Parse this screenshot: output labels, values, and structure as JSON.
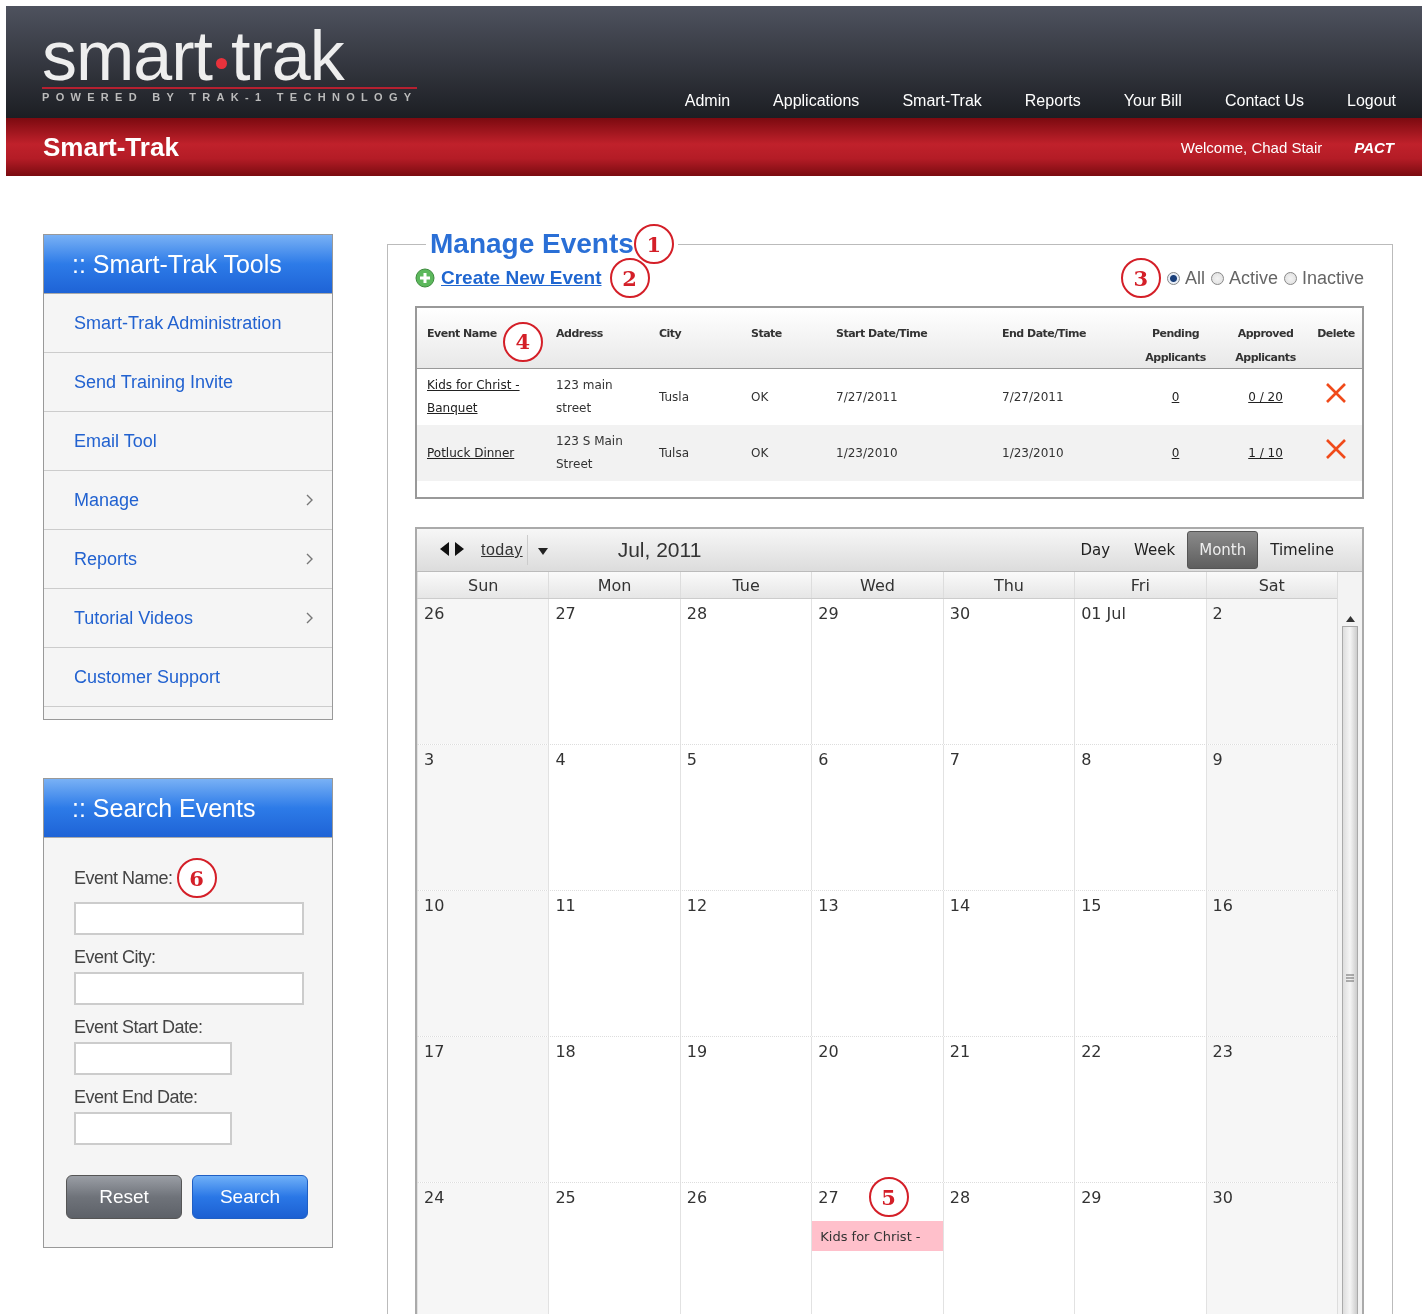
{
  "logo": {
    "left": "smart",
    "right": "trak",
    "tagline": "POWERED BY TRAK-1 TECHNOLOGY"
  },
  "nav": [
    "Admin",
    "Applications",
    "Smart-Trak",
    "Reports",
    "Your Bill",
    "Contact Us",
    "Logout"
  ],
  "banner": {
    "title": "Smart-Trak",
    "welcome": "Welcome, Chad Stair",
    "org": "PACT"
  },
  "tools": {
    "title": ":: Smart-Trak Tools",
    "items": [
      {
        "label": "Smart-Trak Administration",
        "submenu": false
      },
      {
        "label": "Send Training Invite",
        "submenu": false
      },
      {
        "label": "Email Tool",
        "submenu": false
      },
      {
        "label": "Manage",
        "submenu": true
      },
      {
        "label": "Reports",
        "submenu": true
      },
      {
        "label": "Tutorial Videos",
        "submenu": true
      },
      {
        "label": "Customer Support",
        "submenu": false
      }
    ]
  },
  "search": {
    "title": ":: Search Events",
    "callout": "6",
    "fields": [
      {
        "label": "Event Name:"
      },
      {
        "label": "Event City:"
      },
      {
        "label": "Event Start Date:"
      },
      {
        "label": "Event End Date:"
      }
    ],
    "buttons": [
      {
        "label": "Reset",
        "kind": "secondary"
      },
      {
        "label": "Search",
        "kind": "primary"
      }
    ]
  },
  "manage": {
    "title": "Manage Events",
    "callout": "1",
    "create": {
      "label": "Create New Event",
      "callout": "2"
    },
    "filter": {
      "callout": "3",
      "options": [
        {
          "label": "All",
          "selected": true
        },
        {
          "label": "Active",
          "selected": false
        },
        {
          "label": "Inactive",
          "selected": false
        }
      ]
    }
  },
  "events_table": {
    "callout": "4",
    "columns": [
      [
        "Event Name"
      ],
      [
        "Address"
      ],
      [
        "City"
      ],
      [
        "State"
      ],
      [
        "Start Date/Time"
      ],
      [
        "End Date/Time"
      ],
      [
        "Pending",
        "Applicants"
      ],
      [
        "Approved",
        "Applicants"
      ],
      [
        "Delete"
      ]
    ],
    "rows": [
      {
        "name": "Kids for Christ - Banquet",
        "address": "123 main street",
        "city": "Tusla",
        "state": "OK",
        "start": "7/27/2011",
        "end": "7/27/2011",
        "pending": "0",
        "approved": "0 / 20"
      },
      {
        "name": "Potluck Dinner",
        "address": "123 S Main Street",
        "city": "Tulsa",
        "state": "OK",
        "start": "1/23/2010",
        "end": "1/23/2010",
        "pending": "0",
        "approved": "1 / 10"
      }
    ]
  },
  "calendar": {
    "today": "today",
    "month": "Jul, 2011",
    "views": [
      {
        "label": "Day",
        "selected": false
      },
      {
        "label": "Week",
        "selected": false
      },
      {
        "label": "Month",
        "selected": true
      },
      {
        "label": "Timeline",
        "selected": false
      }
    ],
    "weekdays": [
      "Sun",
      "Mon",
      "Tue",
      "Wed",
      "Thu",
      "Fri",
      "Sat"
    ],
    "weeks": [
      [
        {
          "day": "26"
        },
        {
          "day": "27"
        },
        {
          "day": "28"
        },
        {
          "day": "29"
        },
        {
          "day": "30"
        },
        {
          "day": "01 Jul"
        },
        {
          "day": "2"
        }
      ],
      [
        {
          "day": "3"
        },
        {
          "day": "4"
        },
        {
          "day": "5"
        },
        {
          "day": "6"
        },
        {
          "day": "7"
        },
        {
          "day": "8"
        },
        {
          "day": "9"
        }
      ],
      [
        {
          "day": "10"
        },
        {
          "day": "11"
        },
        {
          "day": "12"
        },
        {
          "day": "13"
        },
        {
          "day": "14"
        },
        {
          "day": "15"
        },
        {
          "day": "16"
        }
      ],
      [
        {
          "day": "17"
        },
        {
          "day": "18"
        },
        {
          "day": "19"
        },
        {
          "day": "20"
        },
        {
          "day": "21"
        },
        {
          "day": "22"
        },
        {
          "day": "23"
        }
      ],
      [
        {
          "day": "24"
        },
        {
          "day": "25"
        },
        {
          "day": "26"
        },
        {
          "day": "27",
          "callout": "5",
          "events": [
            "Kids for Christ -"
          ]
        },
        {
          "day": "28"
        },
        {
          "day": "29"
        },
        {
          "day": "30"
        }
      ]
    ]
  }
}
